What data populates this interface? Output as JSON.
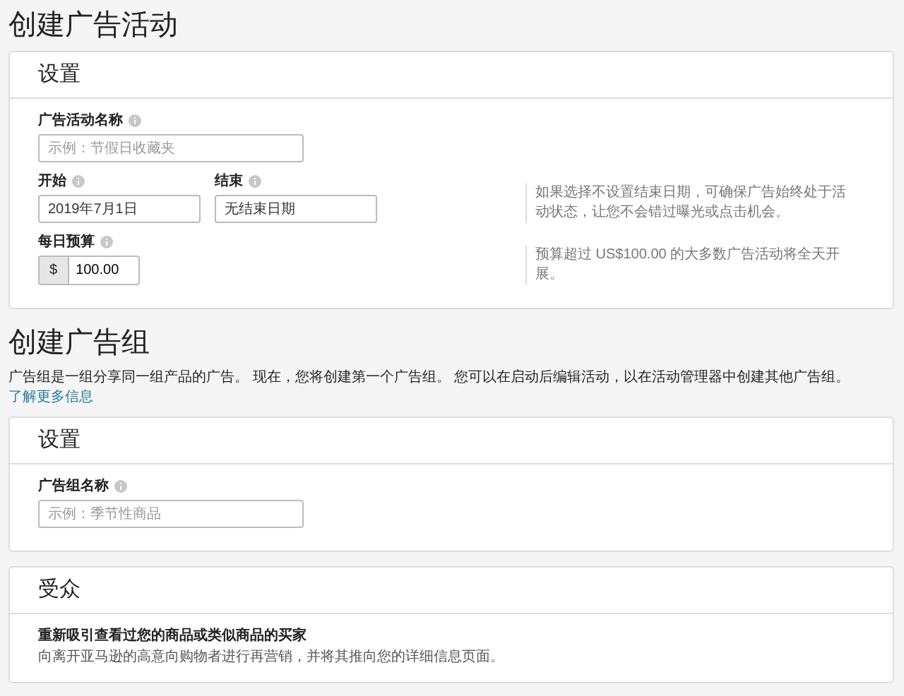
{
  "page_title": "创建广告活动",
  "campaign_settings": {
    "title": "设置",
    "rows": [
      {
        "fields": [
          {
            "kind": "text",
            "label": "广告活动名称",
            "placeholder": "示例：节假日收藏夹"
          }
        ]
      },
      {
        "fields": [
          {
            "kind": "text",
            "label": "开始",
            "value": "2019年7月1日"
          },
          {
            "kind": "text",
            "label": "结束",
            "value": "无结束日期"
          }
        ],
        "hint": "如果选择不设置结束日期，可确保广告始终处于活动状态，让您不会错过曝光或点击机会。"
      },
      {
        "fields": [
          {
            "kind": "currency",
            "label": "每日预算",
            "prefix": "$",
            "value": "100.00"
          }
        ],
        "hint": "预算超过 US$100.00 的大多数广告活动将全天开展。"
      }
    ]
  },
  "ad_group": {
    "title": "创建广告组",
    "description": "广告组是一组分享同一组产品的广告。 现在，您将创建第一个广告组。 您可以在启动后编辑活动，以在活动管理器中创建其他广告组。",
    "link": "了解更多信息"
  },
  "ad_group_settings": {
    "title": "设置",
    "rows": [
      {
        "fields": [
          {
            "kind": "text",
            "label": "广告组名称",
            "placeholder": "示例：季节性商品"
          }
        ]
      }
    ]
  },
  "audience": {
    "title": "受众",
    "option_title": "重新吸引查看过您的商品或类似商品的买家",
    "option_description": "向离开亚马逊的高意向购物者进行再营销，并将其推向您的详细信息页面。"
  }
}
